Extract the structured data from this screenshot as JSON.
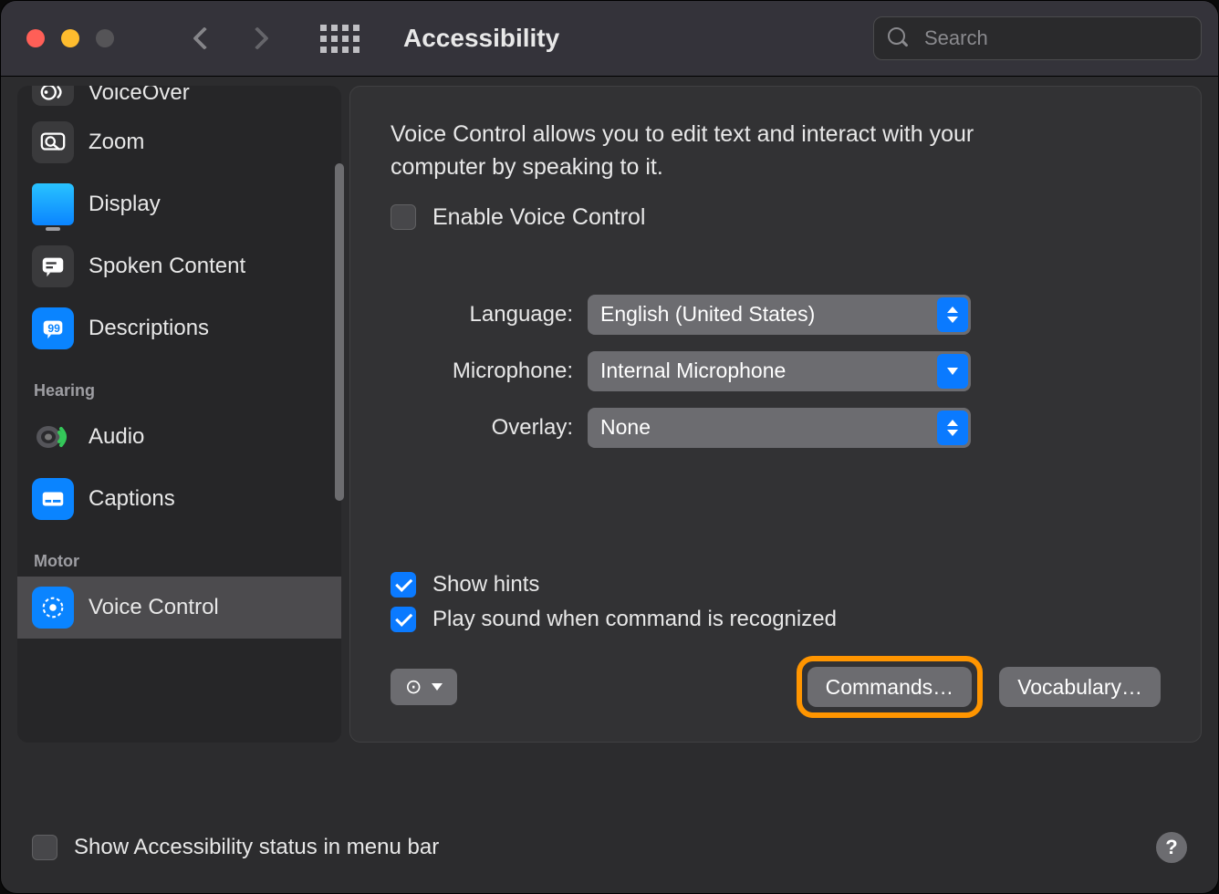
{
  "window": {
    "title": "Accessibility"
  },
  "search": {
    "placeholder": "Search"
  },
  "sidebar": {
    "groups": {
      "hearing": "Hearing",
      "motor": "Motor"
    },
    "items": [
      {
        "label": "VoiceOver"
      },
      {
        "label": "Zoom"
      },
      {
        "label": "Display"
      },
      {
        "label": "Spoken Content"
      },
      {
        "label": "Descriptions"
      },
      {
        "label": "Audio"
      },
      {
        "label": "Captions"
      },
      {
        "label": "Voice Control"
      }
    ]
  },
  "panel": {
    "description": "Voice Control allows you to edit text and interact with your computer by speaking to it.",
    "enable_label": "Enable Voice Control",
    "language_label": "Language:",
    "language_value": "English (United States)",
    "microphone_label": "Microphone:",
    "microphone_value": "Internal Microphone",
    "overlay_label": "Overlay:",
    "overlay_value": "None",
    "show_hints_label": "Show hints",
    "play_sound_label": "Play sound when command is recognized",
    "commands_button": "Commands…",
    "vocabulary_button": "Vocabulary…"
  },
  "footer": {
    "menubar_label": "Show Accessibility status in menu bar",
    "help_symbol": "?"
  }
}
